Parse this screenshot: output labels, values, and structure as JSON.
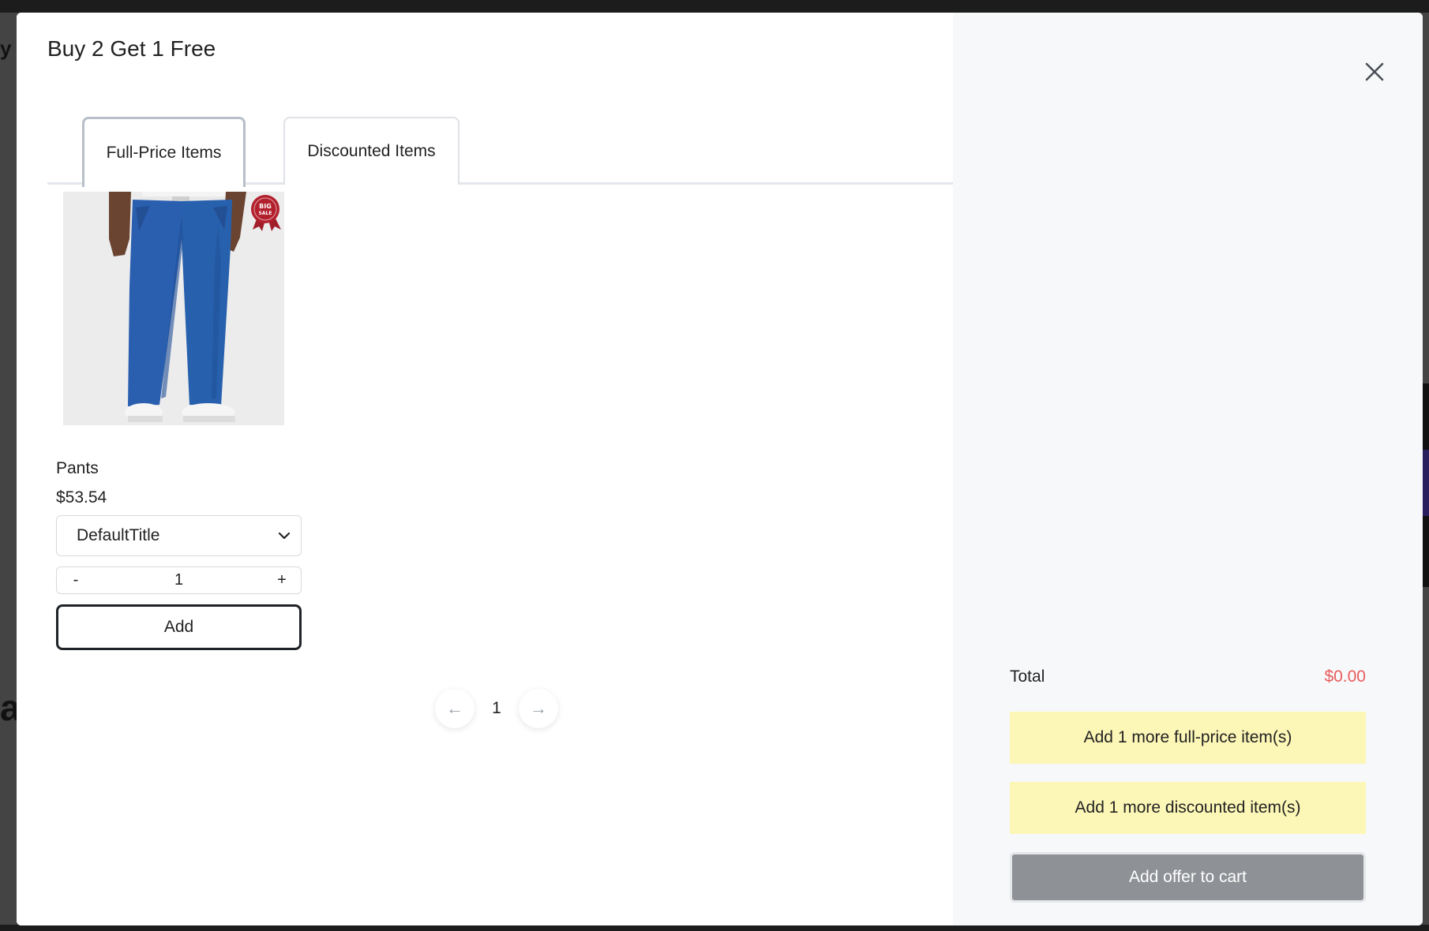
{
  "modal": {
    "title": "Buy 2 Get 1 Free",
    "tabs": [
      {
        "label": "Full-Price Items",
        "active": true
      },
      {
        "label": "Discounted Items",
        "active": false
      }
    ],
    "product": {
      "name": "Pants",
      "price": "$53.54",
      "variant": "DefaultTitle",
      "quantity": "1",
      "qty_minus": "-",
      "qty_plus": "+",
      "add_label": "Add",
      "badge_line1": "BIG",
      "badge_line2": "SALE"
    },
    "pagination": {
      "prev": "←",
      "page": "1",
      "next": "→"
    }
  },
  "summary": {
    "total_label": "Total",
    "total_value": "$0.00",
    "notice_full_price": "Add 1 more full-price item(s)",
    "notice_discounted": "Add 1 more discounted item(s)",
    "cart_button": "Add offer to cart"
  },
  "colors": {
    "total_value": "#e85d5d",
    "notice_bg": "#fdf7b7",
    "cart_button_disabled": "#8e9196",
    "pants_blue": "#2a5fb0"
  },
  "icons": {
    "close": "close-icon",
    "select_chevron": "chevron-down-icon"
  }
}
